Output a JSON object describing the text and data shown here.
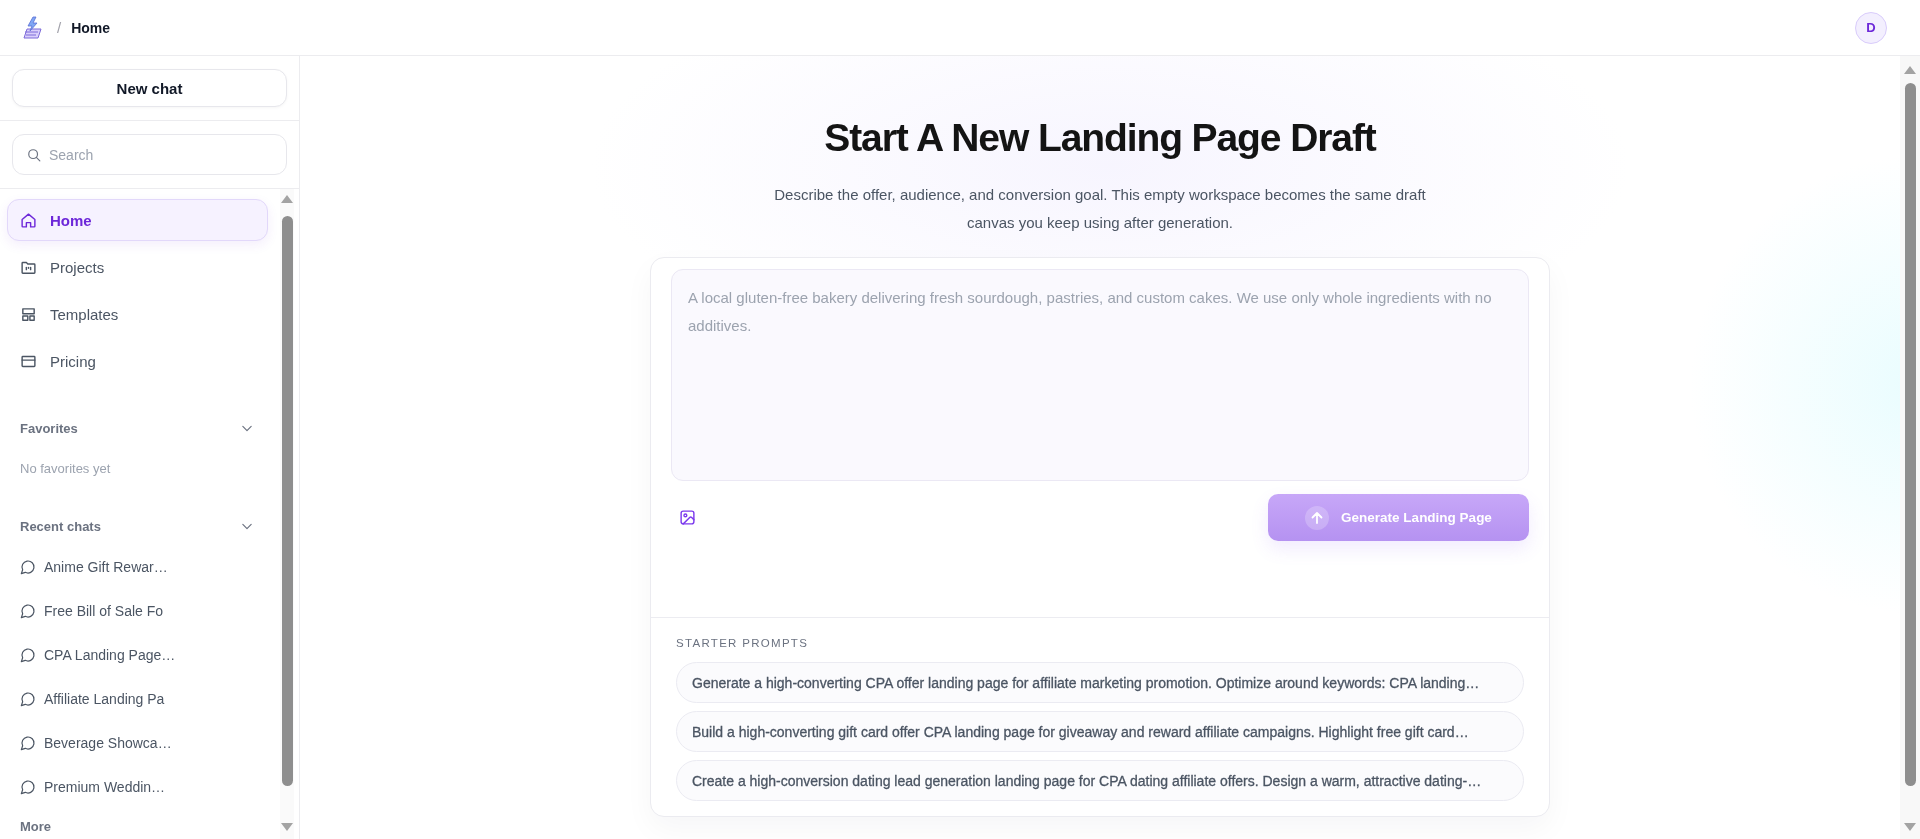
{
  "header": {
    "breadcrumb": {
      "separator": "/",
      "current": "Home"
    },
    "avatar": {
      "initial": "D"
    }
  },
  "sidebar": {
    "new_chat": "New chat",
    "search": {
      "placeholder": "Search"
    },
    "nav": [
      {
        "label": "Home",
        "selected": true
      },
      {
        "label": "Projects",
        "selected": false
      },
      {
        "label": "Templates",
        "selected": false
      },
      {
        "label": "Pricing",
        "selected": false
      }
    ],
    "favorites": {
      "title": "Favorites",
      "expanded": true,
      "empty_text": "No favorites yet"
    },
    "recent_chats": {
      "title": "Recent chats",
      "expanded": true,
      "items": [
        {
          "title": "Anime Gift Rewar…",
          "selected": false
        },
        {
          "title": "Free Bill of Sale Fo",
          "selected": false
        },
        {
          "title": "CPA Landing Page…",
          "selected": false
        },
        {
          "title": "Affiliate Landing Pa",
          "selected": false
        },
        {
          "title": "Beverage Showca…",
          "selected": false
        },
        {
          "title": "Premium Weddin…",
          "selected": false
        }
      ]
    },
    "more": "More"
  },
  "main": {
    "title": "Start A New Landing Page Draft",
    "subtitle": "Describe the offer, audience, and conversion goal. This empty workspace becomes the same draft canvas you keep using after generation.",
    "composer": {
      "placeholder": "A local gluten-free bakery delivering fresh sourdough, pastries, and custom cakes. We use only whole ingredients with no additives.",
      "submit": {
        "label": "Generate Landing Page",
        "disabled": true
      }
    },
    "starter_prompts": {
      "title": "STARTER PROMPTS",
      "items": [
        "Generate a high-converting CPA offer landing page for affiliate marketing promotion. Optimize around keywords: CPA landing…",
        "Build a high-converting gift card offer CPA landing page for giveaway and reward affiliate campaigns. Highlight free gift card…",
        "Create a high-conversion dating lead generation landing page for CPA dating affiliate offers. Design a warm, attractive dating-…"
      ]
    }
  }
}
